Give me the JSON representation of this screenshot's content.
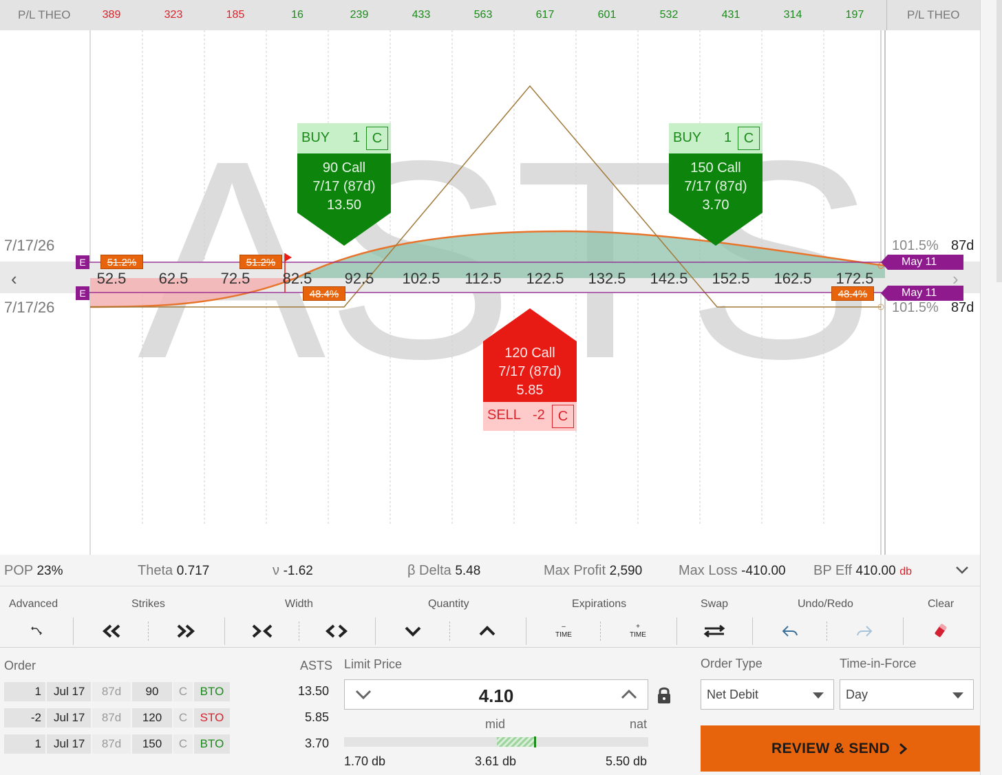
{
  "pl_row": {
    "label_left": "P/L THEO",
    "label_right": "P/L THEO",
    "values": [
      {
        "v": "389",
        "color": "red"
      },
      {
        "v": "323",
        "color": "red"
      },
      {
        "v": "185",
        "color": "red"
      },
      {
        "v": "16",
        "color": "green"
      },
      {
        "v": "239",
        "color": "green"
      },
      {
        "v": "433",
        "color": "green"
      },
      {
        "v": "563",
        "color": "green"
      },
      {
        "v": "617",
        "color": "green"
      },
      {
        "v": "601",
        "color": "green"
      },
      {
        "v": "532",
        "color": "green"
      },
      {
        "v": "431",
        "color": "green"
      },
      {
        "v": "314",
        "color": "green"
      },
      {
        "v": "197",
        "color": "green"
      }
    ]
  },
  "chart": {
    "symbol": "ASTS",
    "date_top": "7/17/26",
    "date_bottom": "7/17/26",
    "strikes": [
      "52.5",
      "62.5",
      "72.5",
      "82.5",
      "92.5",
      "102.5",
      "112.5",
      "122.5",
      "132.5",
      "142.5",
      "152.5",
      "162.5",
      "172.5"
    ],
    "prob_badges": [
      "51.2%",
      "51.2%",
      "48.4%",
      "48.4%"
    ],
    "e_marker": "E",
    "right_top": {
      "pct": "101.5%",
      "days": "87d",
      "date": "May 11"
    },
    "right_bottom": {
      "pct": "101.5%",
      "days": "87d",
      "date": "May 11"
    },
    "colors": {
      "profit_fill": "#9cc9b6",
      "loss_fill": "#f3b1b1",
      "curve": "#e8742c",
      "payoff": "#a07a3a",
      "purple": "#8e1a8e"
    }
  },
  "legs": [
    {
      "side": "BUY",
      "qty": "1",
      "cp": "C",
      "name": "90 Call",
      "exp": "7/17 (87d)",
      "price": "13.50"
    },
    {
      "side": "BUY",
      "qty": "1",
      "cp": "C",
      "name": "150 Call",
      "exp": "7/17 (87d)",
      "price": "3.70"
    },
    {
      "side": "SELL",
      "qty": "-2",
      "cp": "C",
      "name": "120 Call",
      "exp": "7/17 (87d)",
      "price": "5.85"
    }
  ],
  "stats": {
    "pop_k": "POP",
    "pop_v": "23%",
    "theta_k": "Theta",
    "theta_v": "0.717",
    "vega_k": "ν",
    "vega_v": "-1.62",
    "delta_k": "β Delta",
    "delta_v": "5.48",
    "maxp_k": "Max Profit",
    "maxp_v": "2,590",
    "maxl_k": "Max Loss",
    "maxl_v": "-410.00",
    "bp_k": "BP Eff",
    "bp_v": "410.00",
    "bp_unit": "db"
  },
  "toolbar": {
    "advanced": "Advanced",
    "strikes": "Strikes",
    "width": "Width",
    "quantity": "Quantity",
    "expirations": "Expirations",
    "swap": "Swap",
    "undo_redo": "Undo/Redo",
    "clear": "Clear",
    "time_minus": "TIME",
    "time_plus": "TIME"
  },
  "order": {
    "label": "Order",
    "symbol": "ASTS",
    "rows": [
      {
        "qty": "1",
        "exp": "Jul 17",
        "dte": "87d",
        "strike": "90",
        "cp": "C",
        "action": "BTO",
        "price": "13.50"
      },
      {
        "qty": "-2",
        "exp": "Jul 17",
        "dte": "87d",
        "strike": "120",
        "cp": "C",
        "action": "STO",
        "price": "5.85"
      },
      {
        "qty": "1",
        "exp": "Jul 17",
        "dte": "87d",
        "strike": "150",
        "cp": "C",
        "action": "BTO",
        "price": "3.70"
      }
    ],
    "limit_label": "Limit Price",
    "limit_value": "4.10",
    "mid_label": "mid",
    "nat_label": "nat",
    "range_low": "1.70 db",
    "range_mid": "3.61 db",
    "range_high": "5.50 db",
    "order_type_label": "Order Type",
    "order_type_value": "Net Debit",
    "tif_label": "Time-in-Force",
    "tif_value": "Day",
    "review_label": "REVIEW & SEND"
  }
}
